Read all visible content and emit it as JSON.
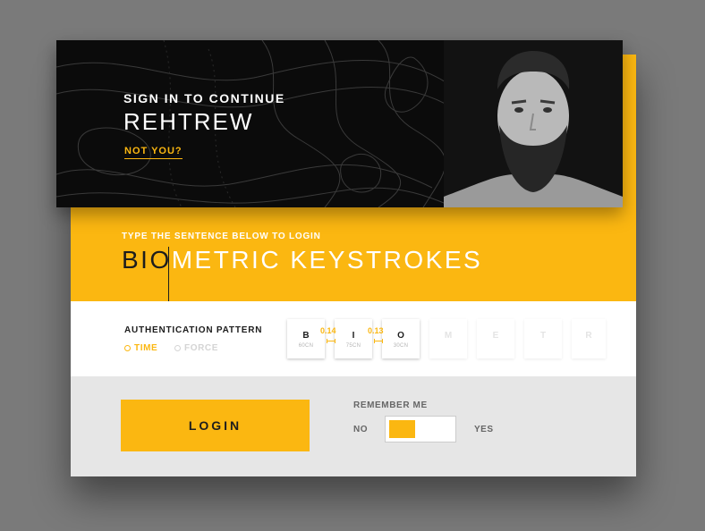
{
  "header": {
    "signin_label": "SIGN IN TO CONTINUE",
    "username": "REHTREW",
    "not_you_link": "NOT YOU?"
  },
  "prompt": {
    "instruction": "TYPE THE SENTENCE BELOW TO LOGIN",
    "typed": "BIO",
    "remaining": "METRIC KEYSTROKES"
  },
  "pattern": {
    "title": "AUTHENTICATION PATTERN",
    "options": [
      "TIME",
      "FORCE"
    ],
    "selected_option": "TIME",
    "keys": [
      {
        "letter": "B",
        "sub": "60CN"
      },
      {
        "letter": "I",
        "sub": "75CN"
      },
      {
        "letter": "O",
        "sub": "30CN"
      },
      {
        "letter": "M",
        "sub": ""
      },
      {
        "letter": "E",
        "sub": ""
      },
      {
        "letter": "T",
        "sub": ""
      },
      {
        "letter": "R",
        "sub": ""
      }
    ],
    "timings": [
      "0.14",
      "0.13"
    ]
  },
  "footer": {
    "login_label": "LOGIN",
    "remember_title": "REMEMBER ME",
    "no_label": "NO",
    "yes_label": "YES",
    "remember_value": false
  },
  "icons": {
    "avatar": "user-photo",
    "option_marker": "radio-dot-icon"
  },
  "colors": {
    "accent": "#fbb711",
    "header_bg": "#0b0b0b",
    "footer_bg": "#e6e6e6",
    "text_dark": "#1d1d1d"
  }
}
